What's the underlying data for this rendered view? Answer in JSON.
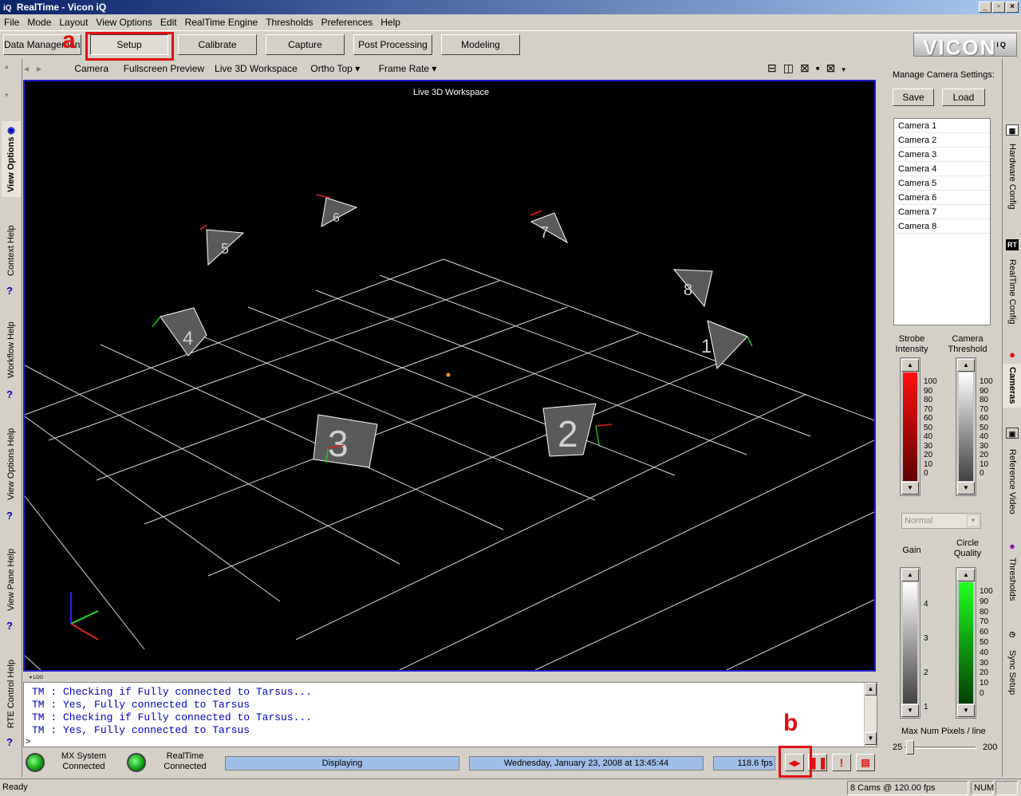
{
  "window": {
    "title": "RealTime - Vicon iQ",
    "icon": "iQ"
  },
  "menu": [
    "File",
    "Mode",
    "Layout",
    "View Options",
    "Edit",
    "RealTime Engine",
    "Thresholds",
    "Preferences",
    "Help"
  ],
  "modes": [
    "Data Management",
    "Setup",
    "Calibrate",
    "Capture",
    "Post Processing",
    "Modeling"
  ],
  "logo": {
    "text": "VICON",
    "sup": "iQ"
  },
  "viewbar": {
    "items": [
      "Camera",
      "Fullscreen Preview",
      "Live 3D Workspace",
      "Ortho Top",
      "Frame Rate"
    ]
  },
  "left_tabs": [
    "View Options",
    "Context Help",
    "Workflow Help",
    "View Options Help",
    "View Pane Help",
    "RTE Control Help"
  ],
  "viewport": {
    "title": "Live 3D Workspace",
    "cameras": [
      "1",
      "2",
      "3",
      "4",
      "5",
      "6",
      "7",
      "8"
    ]
  },
  "log": {
    "header": "LOG",
    "lines": [
      "TM : Checking if Fully connected to Tarsus...",
      "TM : Yes, Fully connected to Tarsus",
      "TM : Checking if Fully connected to Tarsus...",
      "TM : Yes, Fully connected to Tarsus"
    ],
    "prompt": ">"
  },
  "status": {
    "mx_line1": "MX System",
    "mx_line2": "Connected",
    "rt_line1": "RealTime",
    "rt_line2": "Connected",
    "display": "Displaying",
    "datetime": "Wednesday, January 23, 2008 at 13:45:44",
    "fps": "118.6 fps"
  },
  "annotations": {
    "a": "a",
    "b": "b"
  },
  "statusbar": {
    "ready": "Ready",
    "cams": "8 Cams @ 120.00 fps",
    "num": "NUM"
  },
  "right_panel": {
    "manage_label": "Manage Camera Settings:",
    "save": "Save",
    "load": "Load",
    "cameras": [
      "Camera 1",
      "Camera 2",
      "Camera 3",
      "Camera 4",
      "Camera 5",
      "Camera 6",
      "Camera 7",
      "Camera 8"
    ],
    "strobe_label_1": "Strobe",
    "strobe_label_2": "Intensity",
    "threshold_label_1": "Camera",
    "threshold_label_2": "Threshold",
    "scale_100": [
      "100",
      "90",
      "80",
      "70",
      "60",
      "50",
      "40",
      "30",
      "20",
      "10",
      "0"
    ],
    "mode_select": "Normal",
    "gain_label": "Gain",
    "circle_label_1": "Circle",
    "circle_label_2": "Quality",
    "gain_scale": [
      "4",
      "3",
      "2",
      "1"
    ],
    "max_pixels_label": "Max Num Pixels / line",
    "max_pixels_min": "25",
    "max_pixels_max": "200"
  },
  "right_tabs": [
    "Hardware Config",
    "RealTime Config",
    "Cameras",
    "Reference Video",
    "Thresholds",
    "Sync Setup"
  ],
  "colors": {
    "accent_red": "#e01010",
    "title_blue": "#0a246a",
    "log_blue": "#0000c8"
  }
}
